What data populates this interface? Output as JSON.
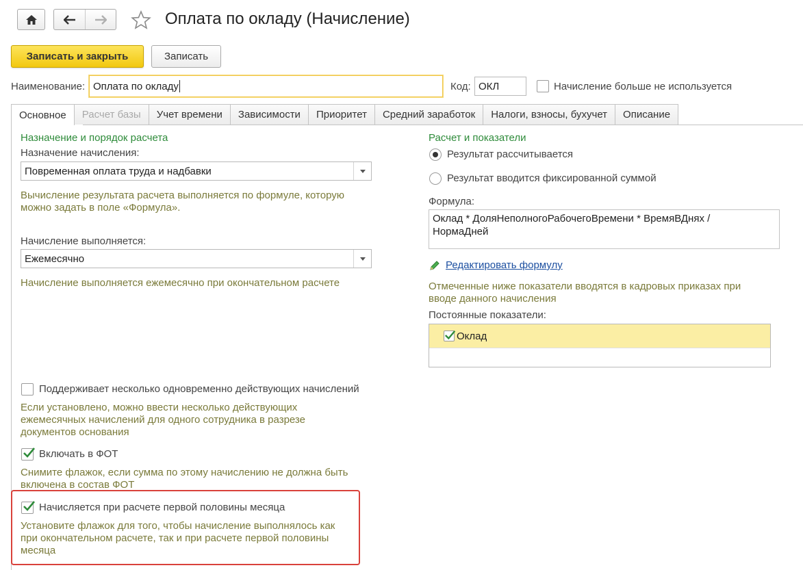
{
  "window": {
    "title": "Оплата по окладу (Начисление)"
  },
  "toolbar": {
    "save_close_label": "Записать и закрыть",
    "save_label": "Записать"
  },
  "header": {
    "name_label": "Наименование:",
    "name_value": "Оплата по окладу",
    "code_label": "Код:",
    "code_value": "ОКЛ",
    "unused_label": "Начисление больше не используется",
    "unused_checked": false
  },
  "tabs": [
    {
      "label": "Основное",
      "active": true
    },
    {
      "label": "Расчет базы",
      "disabled": true
    },
    {
      "label": "Учет времени"
    },
    {
      "label": "Зависимости"
    },
    {
      "label": "Приоритет"
    },
    {
      "label": "Средний заработок"
    },
    {
      "label": "Налоги, взносы, бухучет"
    },
    {
      "label": "Описание"
    }
  ],
  "left": {
    "section_title": "Назначение и порядок расчета",
    "purpose_label": "Назначение начисления:",
    "purpose_value": "Повременная оплата труда и надбавки",
    "purpose_hint_1": "Вычисление результата расчета выполняется по формуле, которую",
    "purpose_hint_2": "можно задать в поле «Формула».",
    "frequency_label": "Начисление выполняется:",
    "frequency_value": "Ежемесячно",
    "frequency_hint": "Начисление выполняется ежемесячно при окончательном расчете",
    "multi_label": "Поддерживает несколько одновременно действующих начислений",
    "multi_checked": false,
    "multi_hint_1": "Если установлено, можно ввести несколько действующих",
    "multi_hint_2": "ежемесячных начислений для одного сотрудника в разрезе",
    "multi_hint_3": "документов основания",
    "fot_label": "Включать в ФОТ",
    "fot_checked": true,
    "fot_hint_1": "Снимите флажок, если сумма по этому начислению не должна быть",
    "fot_hint_2": "включена в состав ФОТ",
    "half_label": "Начисляется при расчете первой половины месяца",
    "half_checked": true,
    "half_hint_1": "Установите флажок для того, чтобы начисление выполнялось как",
    "half_hint_2": "при окончательном расчете, так и при расчете первой половины",
    "half_hint_3": "месяца"
  },
  "right": {
    "section_title": "Расчет и показатели",
    "radio_calculated": "Результат рассчитывается",
    "radio_fixed": "Результат вводится фиксированной суммой",
    "radio_selected": "calculated",
    "formula_label": "Формула:",
    "formula_line_1": "Оклад * ДоляНеполногоРабочегоВремени * ВремяВДнях /",
    "formula_line_2": "НормаДней",
    "edit_formula_link": "Редактировать формулу",
    "indicators_hint_1": "Отмеченные ниже показатели вводятся в кадровых приказах при",
    "indicators_hint_2": "вводе данного начисления",
    "constant_label": "Постоянные показатели:",
    "constant_items": [
      {
        "label": "Оклад",
        "checked": true
      }
    ]
  },
  "colors": {
    "accent_yellow": "#f2c80f",
    "section_green": "#2e8b3a",
    "highlight_red": "#d9413b",
    "link_blue": "#1c4fa0"
  },
  "icons": [
    "home-icon",
    "arrow-left-icon",
    "arrow-right-icon",
    "star-icon",
    "chevron-down-icon",
    "pencil-icon",
    "checkmark-icon"
  ]
}
